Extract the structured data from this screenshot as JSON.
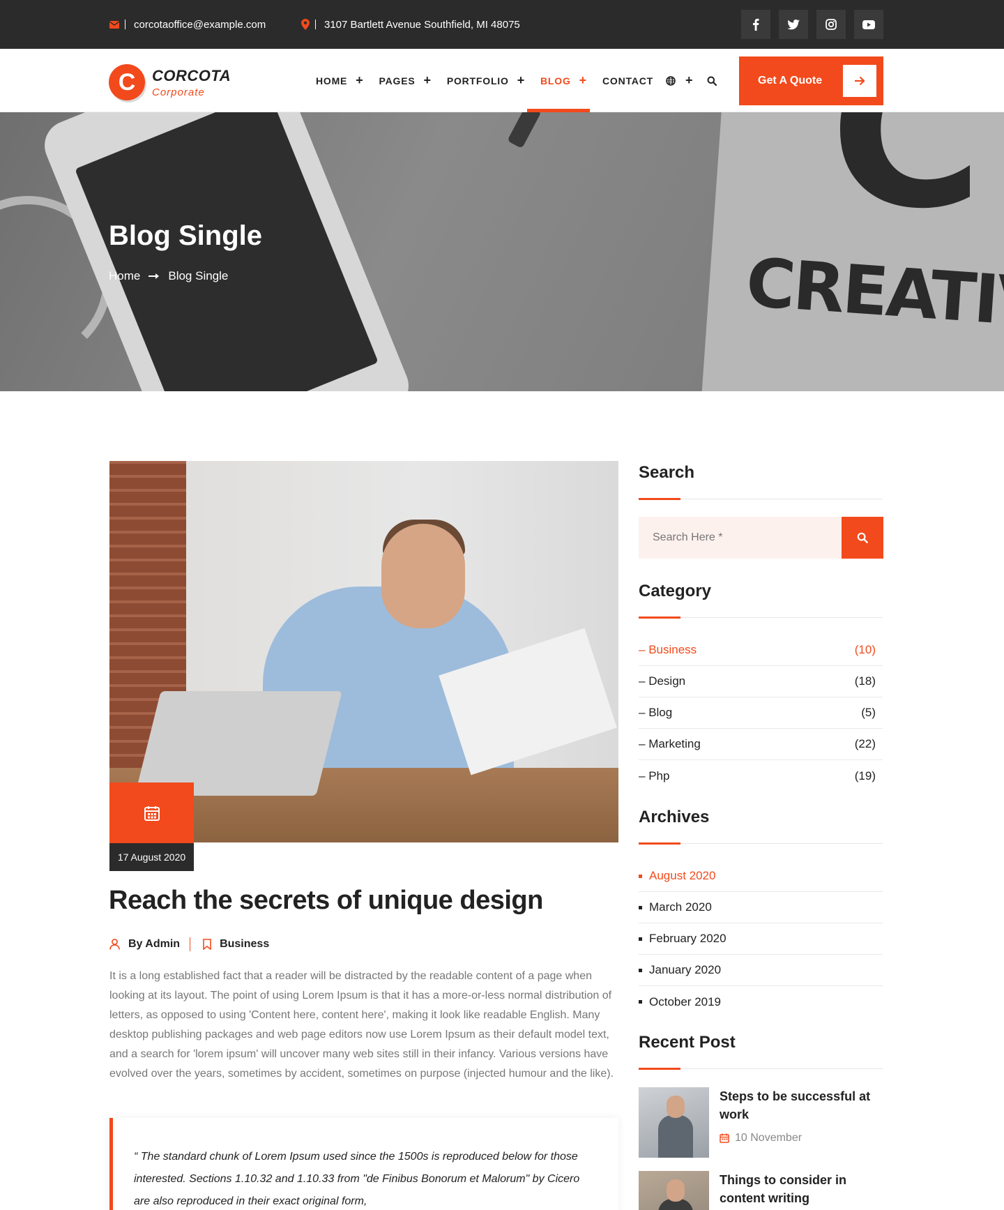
{
  "topbar": {
    "email": "corcotaoffice@example.com",
    "address": "3107 Bartlett Avenue Southfield, MI 48075",
    "social": [
      "facebook-icon",
      "twitter-icon",
      "instagram-icon",
      "youtube-icon"
    ]
  },
  "brand": {
    "mark": "C",
    "name": "CORCOTA",
    "tagline": "Corporate",
    "accent": "#f24a1c",
    "dark": "#2b2b2b"
  },
  "nav": {
    "items": [
      {
        "label": "HOME",
        "has_submenu": true
      },
      {
        "label": "PAGES",
        "has_submenu": true
      },
      {
        "label": "PORTFOLIO",
        "has_submenu": true
      },
      {
        "label": "BLOG",
        "has_submenu": true,
        "active": true
      },
      {
        "label": "CONTACT",
        "has_submenu": false
      }
    ],
    "quote_button": "Get A Quote"
  },
  "hero": {
    "title": "Blog Single",
    "breadcrumb": {
      "home": "Home",
      "current": "Blog Single"
    },
    "bg_text": "CREATIVE"
  },
  "post": {
    "date": "17 August 2020",
    "title": "Reach the secrets of unique design",
    "author": "By Admin",
    "category": "Business",
    "body": "It is a long established fact that a reader will be distracted by the readable content of a page when looking at its layout. The point of using Lorem Ipsum is that it has a more-or-less normal distribution of letters, as opposed to using 'Content here, content here', making it look like readable English. Many desktop publishing packages and web page editors now use Lorem Ipsum as their default model text, and a search for 'lorem ipsum' will uncover many web sites still in their infancy. Various versions have evolved over the years, sometimes by accident, sometimes on purpose (injected humour and the like).",
    "quote": "“ The standard chunk of Lorem Ipsum used since the 1500s is reproduced below for those interested. Sections 1.10.32 and 1.10.33 from \"de Finibus Bonorum et Malorum\" by Cicero are also reproduced in their exact original form,"
  },
  "sidebar": {
    "search": {
      "title": "Search",
      "placeholder": "Search Here *"
    },
    "category": {
      "title": "Category",
      "items": [
        {
          "name": "Business",
          "count": "(10)",
          "active": true
        },
        {
          "name": "Design",
          "count": "(18)"
        },
        {
          "name": "Blog",
          "count": "(5)"
        },
        {
          "name": "Marketing",
          "count": "(22)"
        },
        {
          "name": "Php",
          "count": "(19)"
        }
      ]
    },
    "archives": {
      "title": "Archives",
      "items": [
        "August 2020",
        "March 2020",
        "February 2020",
        "January 2020",
        "October 2019"
      ]
    },
    "recent": {
      "title": "Recent Post",
      "items": [
        {
          "title": "Steps to be successful at work",
          "date": "10 November"
        },
        {
          "title": "Things to consider in content writing",
          "date": ""
        }
      ]
    }
  }
}
